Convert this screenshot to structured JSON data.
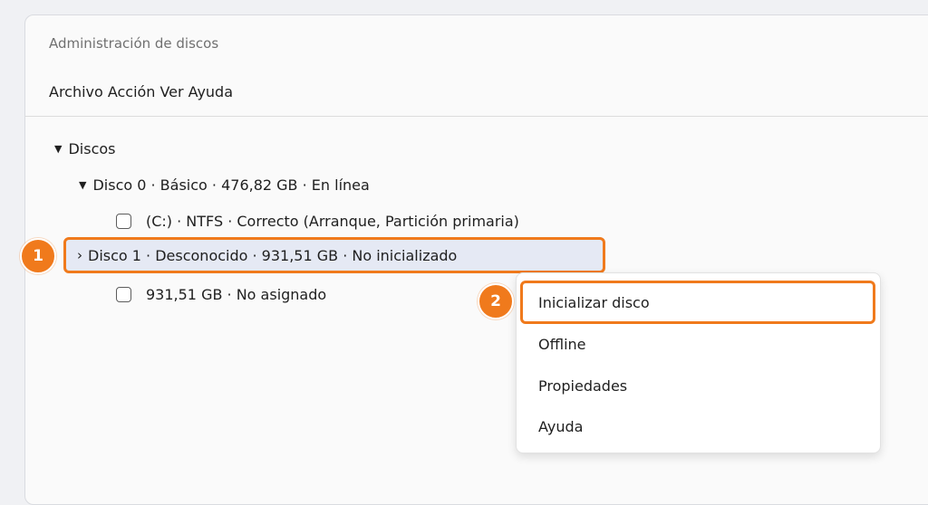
{
  "window": {
    "title": "Administración de discos"
  },
  "menubar": {
    "items": [
      "Archivo",
      "Acción",
      "Ver",
      "Ayuda"
    ]
  },
  "tree": {
    "root_label": "Discos",
    "disk0_label": "Disco 0 · Básico · 476,82 GB · En línea",
    "disk0_partition": "(C:) · NTFS · Correcto (Arranque, Partición primaria)",
    "disk1_label": "Disco 1 · Desconocido · 931,51 GB · No inicializado",
    "disk1_unallocated": "931,51 GB · No asignado"
  },
  "context_menu": {
    "items": [
      "Inicializar disco",
      "Offline",
      "Propiedades",
      "Ayuda"
    ]
  },
  "annotations": {
    "step1": "1",
    "step2": "2"
  },
  "colors": {
    "accent": "#f07a1c",
    "selected_row": "#e5e9f4"
  }
}
